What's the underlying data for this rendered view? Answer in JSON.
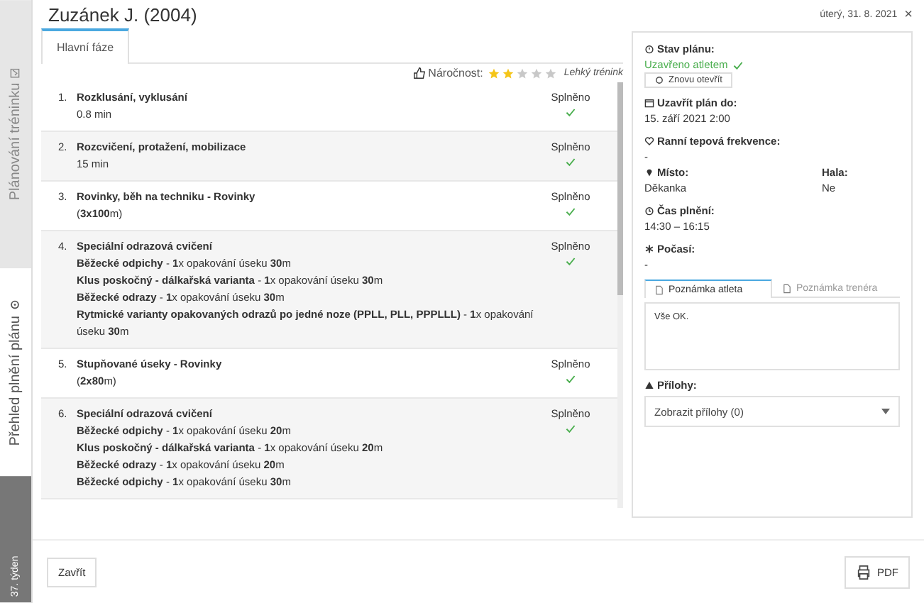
{
  "side_tabs": [
    {
      "label": "Plánování tréninku",
      "selected": false
    },
    {
      "label": "Přehled plnění plánu",
      "selected": true
    }
  ],
  "side_week": "37. týden",
  "title": "Zuzánek J. (2004)",
  "date": "úterý, 31. 8. 2021",
  "close": "×",
  "tabs": [
    {
      "label": "Hlavní fáze",
      "selected": true
    }
  ],
  "difficulty": {
    "label": "Náročnost:",
    "stars": 2,
    "note": "Lehký trénink"
  },
  "exercises": [
    {
      "number": "1.",
      "title": "Rozklusání, vyklusání",
      "details": [
        "0.8 min"
      ],
      "status": "Splněno",
      "done": true
    },
    {
      "number": "2.",
      "title": "Rozcvičení, protažení, mobilizace",
      "details": [
        "15 min"
      ],
      "status": "Splněno",
      "done": true
    },
    {
      "number": "3.",
      "title": "Rovinky, běh na techniku - Rovinky",
      "details": [
        "(**3x100**m)"
      ],
      "status": "Splněno",
      "done": true
    },
    {
      "number": "4.",
      "title": "Speciální odrazová cvičení",
      "details": [
        "**Běžecké odpichy** - **1**x opakování úseku **30**m",
        "**Klus poskočný - dálkařská varianta** - **1**x opakování úseku **30**m",
        "**Běžecké odrazy** - **1**x opakování úseku **30**m",
        "**Rytmické varianty opakovaných odrazů po jedné noze (PPLL, PLL, PPPLLL)** - **1**x opakování úseku **30**m"
      ],
      "status": "Splněno",
      "done": true
    },
    {
      "number": "5.",
      "title": "Stupňované úseky - Rovinky",
      "details": [
        "(**2x80**m)"
      ],
      "status": "Splněno",
      "done": true
    },
    {
      "number": "6.",
      "title": "Speciální odrazová cvičení",
      "details": [
        "**Běžecké odpichy** - **1**x opakování úseku **20**m",
        "**Klus poskočný - dálkařská varianta** - **1**x opakování úseku **20**m",
        "**Běžecké odrazy** - **1**x opakování úseku **20**m",
        "**Běžecké odpichy** - **1**x opakování úseku **30**m"
      ],
      "status": "Splněno",
      "done": true
    }
  ],
  "panel": {
    "plan_state": {
      "label": "Stav plánu:",
      "value": "Uzavřeno atletem",
      "closed": true,
      "button": "Znovu otevřít"
    },
    "fields": [
      {
        "kind": "calendar",
        "label": "Uzavřít plán do:",
        "value": "15. září 2021 2:00"
      },
      {
        "kind": "heart",
        "label": "Ranní tepová frekvence:",
        "value": "-"
      },
      {
        "kind": "pin",
        "label": "Místo:",
        "value": "Děkanka",
        "side_label": "Hala:",
        "side_value": "Ne"
      },
      {
        "kind": "clock",
        "label": "Čas plnění:",
        "value": "14:30 – 16:15"
      },
      {
        "kind": "snow",
        "label": "Počasí:",
        "value": "-"
      }
    ],
    "note_tabs": [
      {
        "label": "Poznámka atleta",
        "selected": true
      },
      {
        "label": "Poznámka trenéra",
        "selected": false
      }
    ],
    "note": "Vše OK.",
    "attachments": {
      "label": "Přílohy:",
      "value": "Zobrazit přílohy (0)"
    }
  },
  "buttons": {
    "close": "Zavřít",
    "pdf": "PDF"
  }
}
